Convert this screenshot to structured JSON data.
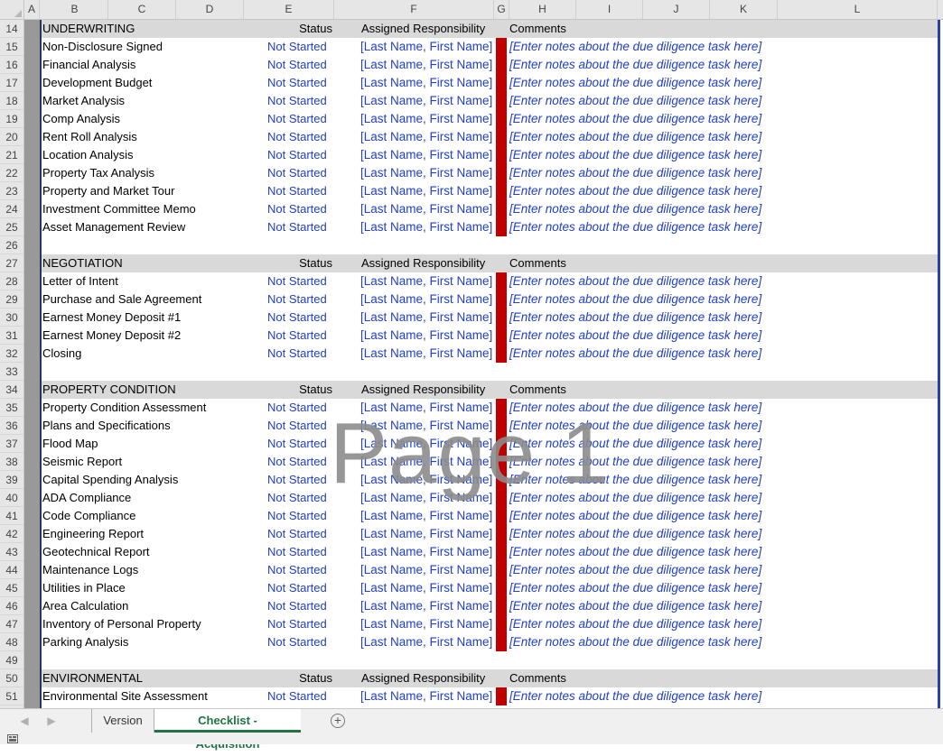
{
  "columns": [
    "A",
    "B",
    "C",
    "D",
    "E",
    "F",
    "G",
    "H",
    "I",
    "J",
    "K",
    "L"
  ],
  "rows": [
    {
      "n": "14",
      "type": "section",
      "title": "UNDERWRITING",
      "status_h": "Status",
      "assign_h": "Assigned Responsibility",
      "comments_h": "Comments"
    },
    {
      "n": "15",
      "type": "task",
      "task": "Non-Disclosure Signed",
      "status": "Not Started",
      "assign": "[Last Name, First Name]",
      "comment": "[Enter notes about the due diligence task here]"
    },
    {
      "n": "16",
      "type": "task",
      "task": "Financial Analysis",
      "status": "Not Started",
      "assign": "[Last Name, First Name]",
      "comment": "[Enter notes about the due diligence task here]"
    },
    {
      "n": "17",
      "type": "task",
      "task": "Development Budget",
      "status": "Not Started",
      "assign": "[Last Name, First Name]",
      "comment": "[Enter notes about the due diligence task here]"
    },
    {
      "n": "18",
      "type": "task",
      "task": "Market Analysis",
      "status": "Not Started",
      "assign": "[Last Name, First Name]",
      "comment": "[Enter notes about the due diligence task here]"
    },
    {
      "n": "19",
      "type": "task",
      "task": "Comp Analysis",
      "status": "Not Started",
      "assign": "[Last Name, First Name]",
      "comment": "[Enter notes about the due diligence task here]"
    },
    {
      "n": "20",
      "type": "task",
      "task": "Rent Roll Analysis",
      "status": "Not Started",
      "assign": "[Last Name, First Name]",
      "comment": "[Enter notes about the due diligence task here]"
    },
    {
      "n": "21",
      "type": "task",
      "task": "Location Analysis",
      "status": "Not Started",
      "assign": "[Last Name, First Name]",
      "comment": "[Enter notes about the due diligence task here]"
    },
    {
      "n": "22",
      "type": "task",
      "task": "Property Tax Analysis",
      "status": "Not Started",
      "assign": "[Last Name, First Name]",
      "comment": "[Enter notes about the due diligence task here]"
    },
    {
      "n": "23",
      "type": "task",
      "task": "Property and Market Tour",
      "status": "Not Started",
      "assign": "[Last Name, First Name]",
      "comment": "[Enter notes about the due diligence task here]"
    },
    {
      "n": "24",
      "type": "task",
      "task": "Investment Committee Memo",
      "status": "Not Started",
      "assign": "[Last Name, First Name]",
      "comment": "[Enter notes about the due diligence task here]"
    },
    {
      "n": "25",
      "type": "task",
      "task": "Asset Management Review",
      "status": "Not Started",
      "assign": "[Last Name, First Name]",
      "comment": "[Enter notes about the due diligence task here]"
    },
    {
      "n": "26",
      "type": "empty"
    },
    {
      "n": "27",
      "type": "section",
      "title": "NEGOTIATION",
      "status_h": "Status",
      "assign_h": "Assigned Responsibility",
      "comments_h": "Comments"
    },
    {
      "n": "28",
      "type": "task",
      "task": "Letter of Intent",
      "status": "Not Started",
      "assign": "[Last Name, First Name]",
      "comment": "[Enter notes about the due diligence task here]"
    },
    {
      "n": "29",
      "type": "task",
      "task": "Purchase and Sale Agreement",
      "status": "Not Started",
      "assign": "[Last Name, First Name]",
      "comment": "[Enter notes about the due diligence task here]"
    },
    {
      "n": "30",
      "type": "task",
      "task": "Earnest Money Deposit #1",
      "status": "Not Started",
      "assign": "[Last Name, First Name]",
      "comment": "[Enter notes about the due diligence task here]"
    },
    {
      "n": "31",
      "type": "task",
      "task": "Earnest Money Deposit #2",
      "status": "Not Started",
      "assign": "[Last Name, First Name]",
      "comment": "[Enter notes about the due diligence task here]"
    },
    {
      "n": "32",
      "type": "task",
      "task": "Closing",
      "status": "Not Started",
      "assign": "[Last Name, First Name]",
      "comment": "[Enter notes about the due diligence task here]"
    },
    {
      "n": "33",
      "type": "empty"
    },
    {
      "n": "34",
      "type": "section",
      "title": "PROPERTY CONDITION",
      "status_h": "Status",
      "assign_h": "Assigned Responsibility",
      "comments_h": "Comments"
    },
    {
      "n": "35",
      "type": "task",
      "task": "Property Condition Assessment",
      "status": "Not Started",
      "assign": "[Last Name, First Name]",
      "comment": "[Enter notes about the due diligence task here]"
    },
    {
      "n": "36",
      "type": "task",
      "task": "Plans and Specifications",
      "status": "Not Started",
      "assign": "[Last Name, First Name]",
      "comment": "[Enter notes about the due diligence task here]"
    },
    {
      "n": "37",
      "type": "task",
      "task": "Flood Map",
      "status": "Not Started",
      "assign": "[Last Name, First Name]",
      "comment": "[Enter notes about the due diligence task here]"
    },
    {
      "n": "38",
      "type": "task",
      "task": "Seismic Report",
      "status": "Not Started",
      "assign": "[Last Name, First Name]",
      "comment": "[Enter notes about the due diligence task here]"
    },
    {
      "n": "39",
      "type": "task",
      "task": "Capital Spending Analysis",
      "status": "Not Started",
      "assign": "[Last Name, First Name]",
      "comment": "[Enter notes about the due diligence task here]"
    },
    {
      "n": "40",
      "type": "task",
      "task": "ADA Compliance",
      "status": "Not Started",
      "assign": "[Last Name, First Name]",
      "comment": "[Enter notes about the due diligence task here]"
    },
    {
      "n": "41",
      "type": "task",
      "task": "Code Compliance",
      "status": "Not Started",
      "assign": "[Last Name, First Name]",
      "comment": "[Enter notes about the due diligence task here]"
    },
    {
      "n": "42",
      "type": "task",
      "task": "Engineering Report",
      "status": "Not Started",
      "assign": "[Last Name, First Name]",
      "comment": "[Enter notes about the due diligence task here]"
    },
    {
      "n": "43",
      "type": "task",
      "task": "Geotechnical Report",
      "status": "Not Started",
      "assign": "[Last Name, First Name]",
      "comment": "[Enter notes about the due diligence task here]"
    },
    {
      "n": "44",
      "type": "task",
      "task": "Maintenance Logs",
      "status": "Not Started",
      "assign": "[Last Name, First Name]",
      "comment": "[Enter notes about the due diligence task here]"
    },
    {
      "n": "45",
      "type": "task",
      "task": "Utilities in Place",
      "status": "Not Started",
      "assign": "[Last Name, First Name]",
      "comment": "[Enter notes about the due diligence task here]"
    },
    {
      "n": "46",
      "type": "task",
      "task": "Area Calculation",
      "status": "Not Started",
      "assign": "[Last Name, First Name]",
      "comment": "[Enter notes about the due diligence task here]"
    },
    {
      "n": "47",
      "type": "task",
      "task": "Inventory of Personal Property",
      "status": "Not Started",
      "assign": "[Last Name, First Name]",
      "comment": "[Enter notes about the due diligence task here]"
    },
    {
      "n": "48",
      "type": "task",
      "task": "Parking Analysis",
      "status": "Not Started",
      "assign": "[Last Name, First Name]",
      "comment": "[Enter notes about the due diligence task here]"
    },
    {
      "n": "49",
      "type": "empty"
    },
    {
      "n": "50",
      "type": "section",
      "title": "ENVIRONMENTAL",
      "status_h": "Status",
      "assign_h": "Assigned Responsibility",
      "comments_h": "Comments"
    },
    {
      "n": "51",
      "type": "task",
      "task": "Environmental Site Assessment",
      "status": "Not Started",
      "assign": "[Last Name, First Name]",
      "comment": "[Enter notes about the due diligence task here]"
    }
  ],
  "watermark": "Page 1",
  "tabs": {
    "version": "Version",
    "checklist": "Checklist - Acquisition",
    "add_label": "+"
  },
  "colors": {
    "status_text": "#1f3ec9",
    "red_bar": "#c00000",
    "section_header_bg": "#d9d9d9",
    "active_tab": "#217346"
  },
  "icons": [
    "scroll-left-icon",
    "scroll-right-icon",
    "add-sheet-icon",
    "macro-record-icon"
  ]
}
